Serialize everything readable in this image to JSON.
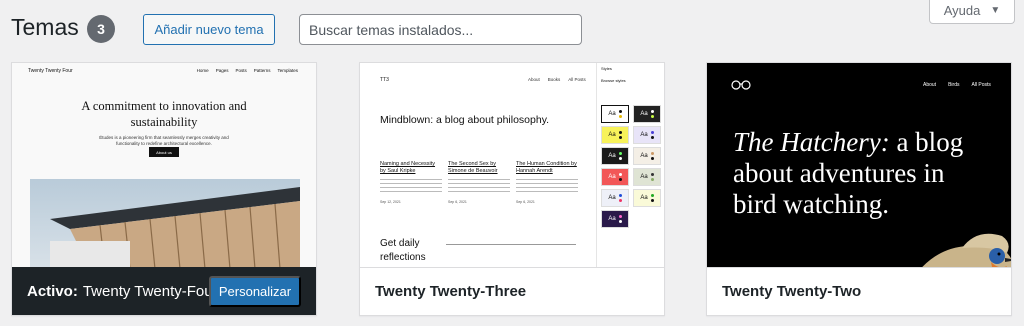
{
  "header": {
    "title": "Temas",
    "count": "3",
    "add_new_label": "Añadir nuevo tema",
    "search_placeholder": "Buscar temas instalados...",
    "help_label": "Ayuda"
  },
  "colors": {
    "accent": "#2271b1",
    "active_bar": "#1d2327",
    "background": "#f0f0f1"
  },
  "themes": [
    {
      "name": "Twenty Twenty-Four",
      "active": true,
      "active_label": "Activo:",
      "customize_label": "Personalizar",
      "preview": {
        "site_title": "Twenty Twenty Four",
        "nav": [
          "Home",
          "Pages",
          "Posts",
          "Patterns",
          "Templates"
        ],
        "headline": "A commitment to innovation and sustainability",
        "subtext": "Études is a pioneering firm that seamlessly merges creativity and functionality to redefine architectural excellence.",
        "button": "About us"
      }
    },
    {
      "name": "Twenty Twenty-Three",
      "active": false,
      "preview": {
        "site_title": "TT3",
        "nav": [
          "About",
          "Books",
          "All Posts"
        ],
        "headline": "Mindblown: a blog about philosophy.",
        "posts": [
          {
            "title": "Naming and Necessity by Saul Kripke",
            "date": "Sep 12, 2021"
          },
          {
            "title": "The Second Sex by Simone de Beauvoir",
            "date": "Sep 6, 2021"
          },
          {
            "title": "The Human Condition by Hannah Arendt",
            "date": "Sep 6, 2021"
          }
        ],
        "footer_heading": "Get daily reflections",
        "sidebar_title": "Styles",
        "sidebar_subtitle": "Browse styles",
        "swatch_label": "Aa"
      }
    },
    {
      "name": "Twenty Twenty-Two",
      "active": false,
      "preview": {
        "nav": [
          "About",
          "Birds",
          "All Posts"
        ],
        "headline_italic": "The Hatchery:",
        "headline_rest": "a blog about adventures in bird watching."
      }
    }
  ]
}
